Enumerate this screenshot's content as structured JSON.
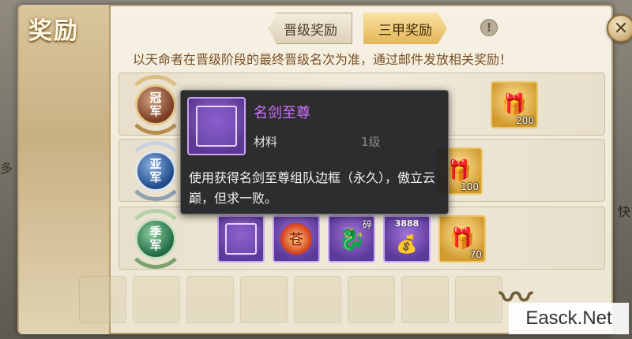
{
  "dialog": {
    "title": "奖励",
    "close_icon": "close-icon",
    "tabs": [
      {
        "label": "晋级奖励",
        "active": false
      },
      {
        "label": "三甲奖励",
        "active": true
      }
    ],
    "info_icon": "!",
    "notice": "以天命者在晋级阶段的最终晋级名次为准，通过邮件发放相关奖励！"
  },
  "ranks": [
    {
      "key": "champion",
      "medal_line1": "冠",
      "medal_line2": "军",
      "medal_color": "#7a3a24",
      "visible_items": [
        {
          "icon": "gift-box-icon",
          "quality": "gold",
          "qty": "200"
        }
      ]
    },
    {
      "key": "runner-up",
      "medal_line1": "亚",
      "medal_line2": "军",
      "medal_color": "#1e4a8a",
      "visible_items": [
        {
          "icon": "gift-box-icon",
          "quality": "gold",
          "qty": "100"
        }
      ]
    },
    {
      "key": "third",
      "medal_line1": "季",
      "medal_line2": "军",
      "medal_color": "#1f6a43",
      "visible_items": [
        {
          "icon": "avatar-frame-icon",
          "quality": "purple",
          "qty": ""
        },
        {
          "icon": "red-orb-icon",
          "quality": "purple",
          "qty": "",
          "glyph": "苍"
        },
        {
          "icon": "dragon-shard-icon",
          "quality": "purple",
          "qty": "",
          "mark": "碎"
        },
        {
          "icon": "money-bag-icon",
          "quality": "purple",
          "qty": "",
          "toplabel": "3888"
        },
        {
          "icon": "gift-box-icon",
          "quality": "gold",
          "qty": "70"
        }
      ]
    }
  ],
  "tooltip": {
    "name": "名剑至尊",
    "type": "材料",
    "level": "1级",
    "description": "使用获得名剑至尊组队边框（永久），傲立云巅，但求一败。",
    "name_color": "#d072ff"
  },
  "background": {
    "left_fragment": "多",
    "right_fragment": "快"
  },
  "watermark": "Easck.Net"
}
